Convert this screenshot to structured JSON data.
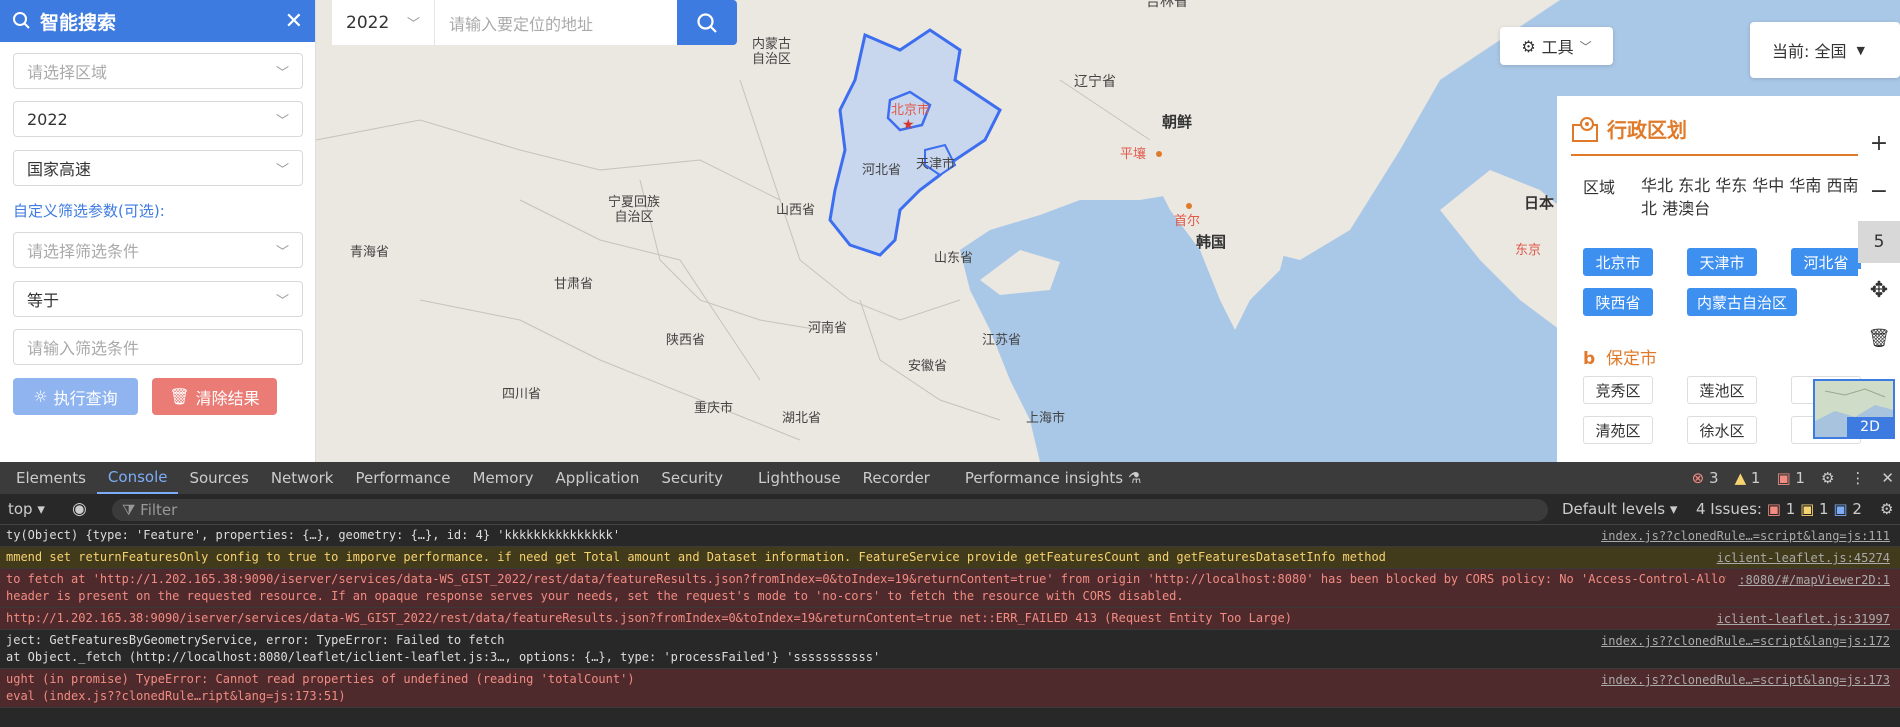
{
  "search_panel": {
    "title": "智能搜索",
    "region_placeholder": "请选择区域",
    "year_value": "2022",
    "road_value": "国家高速",
    "custom_label": "自定义筛选参数(可选):",
    "condition_placeholder": "请选择筛选条件",
    "operator_value": "等于",
    "input_placeholder": "请输入筛选条件",
    "run_label": "执行查询",
    "clear_label": "清除结果"
  },
  "topbar": {
    "year": "2022",
    "address_placeholder": "请输入要定位的地址"
  },
  "tools_label": "工具",
  "current_label": "当前: 全国",
  "map_labels": {
    "jilin": "吉林省",
    "neimenggu": "内蒙古\n自治区",
    "liaoning": "辽宁省",
    "chaoxian": "朝鲜",
    "beijing": "北京市",
    "hebei": "河北省",
    "tianjin": "天津市",
    "pingrang": "平壤",
    "shouer": "首尔",
    "hanguo": "韩国",
    "riben": "日本",
    "dongjing": "东京",
    "ningxia": "宁夏回族\n自治区",
    "shanxi": "山西省",
    "shandong": "山东省",
    "qinghai": "青海省",
    "gansu": "甘肃省",
    "shaanxi": "陕西省",
    "henan": "河南省",
    "jiangsu": "江苏省",
    "anhui": "安徽省",
    "sichuan": "四川省",
    "chongqing": "重庆市",
    "hubei": "湖北省",
    "shanghai": "上海市"
  },
  "admin_panel": {
    "title": "行政区划",
    "region_label": "区域",
    "regions": "华北 东北 华东 华中 华南 西南 西北 港澳台",
    "provinces": [
      "北京市",
      "天津市",
      "河北省",
      "陕西省",
      "内蒙古自治区"
    ],
    "section_letter": "b",
    "section_city": "保定市",
    "districts": [
      "竞秀区",
      "莲池区",
      "清苑区",
      "徐水区"
    ]
  },
  "zoom_level": "5",
  "minimap_label": "2D",
  "devtools": {
    "tabs": [
      "Elements",
      "Console",
      "Sources",
      "Network",
      "Performance",
      "Memory",
      "Application",
      "Security",
      "Lighthouse",
      "Recorder",
      "Performance insights"
    ],
    "error_count": "3",
    "warn_count": "1",
    "info_count": "1",
    "context": "top",
    "filter_placeholder": "Filter",
    "levels": "Default levels",
    "issues_label": "4 Issues:",
    "issues_err": "1",
    "issues_warn": "1",
    "issues_info": "2",
    "logs": [
      {
        "text": "ty(Object)  {type: 'Feature', properties: {…}, geometry: {…}, id: 4} 'kkkkkkkkkkkkkkk'",
        "src": "index.js??clonedRule…=script&lang=js:111",
        "level": "info"
      },
      {
        "text": "mmend set returnFeaturesOnly config to true to imporve performance. if need get Total amount and Dataset information. FeatureService provide getFeaturesCount and getFeaturesDatasetInfo method",
        "src": "iclient-leaflet.js:45274",
        "level": "warn"
      },
      {
        "text": " to fetch at 'http://1.202.165.38:9090/iserver/services/data-WS_GIST_2022/rest/data/featureResults.json?fromIndex=0&toIndex=19&returnContent=true' from origin 'http://localhost:8080' has been blocked by CORS policy: No 'Access-Control-Allow-",
        "text2": " header is present on the requested resource. If an opaque response serves your needs, set the request's mode to 'no-cors' to fetch the resource with CORS disabled.",
        "src": ":8080/#/mapViewer2D:1",
        "level": "err"
      },
      {
        "text": " http://1.202.165.38:9090/iserver/services/data-WS_GIST_2022/rest/data/featureResults.json?fromIndex=0&toIndex=19&returnContent=true net::ERR_FAILED 413 (Request Entity Too Large)",
        "src": "iclient-leaflet.js:31997",
        "level": "err"
      },
      {
        "text": "ject: GetFeaturesByGeometryService, error: TypeError: Failed to fetch",
        "text2": " at Object._fetch (http://localhost:8080/leaflet/iclient-leaflet.js:3…, options: {…}, type: 'processFailed'} 'sssssssssss'",
        "src": "index.js??clonedRule…=script&lang=js:172",
        "level": "info"
      },
      {
        "text": "ught (in promise) TypeError: Cannot read properties of undefined (reading 'totalCount')",
        "text2": " eval (index.js??clonedRule…ript&lang=js:173:51)",
        "src": "index.js??clonedRule…=script&lang=js:173",
        "level": "err"
      }
    ]
  }
}
